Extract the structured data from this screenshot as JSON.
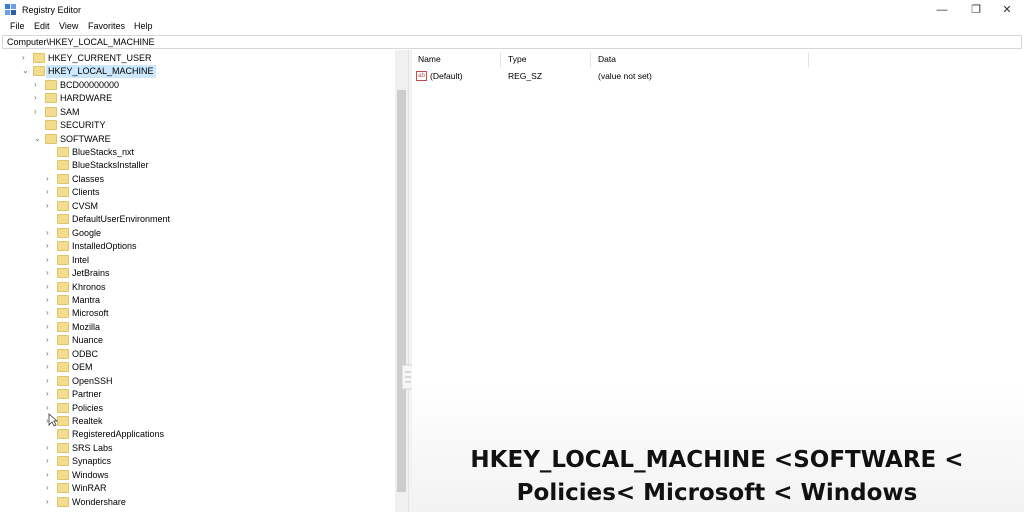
{
  "window": {
    "title": "Registry Editor",
    "minimize": "—",
    "maximize": "❐",
    "close": "✕"
  },
  "menu": [
    "File",
    "Edit",
    "View",
    "Favorites",
    "Help"
  ],
  "address": "Computer\\HKEY_LOCAL_MACHINE",
  "tree": {
    "roots": [
      {
        "label": "HKEY_CURRENT_USER",
        "expanded": false
      },
      {
        "label": "HKEY_LOCAL_MACHINE",
        "expanded": true,
        "selected": true
      }
    ],
    "hklm_children": [
      "BCD00000000",
      "HARDWARE",
      "SAM",
      "SECURITY",
      "SOFTWARE"
    ],
    "software_children": [
      "BlueStacks_nxt",
      "BlueStacksInstaller",
      "Classes",
      "Clients",
      "CVSM",
      "DefaultUserEnvironment",
      "Google",
      "InstalledOptions",
      "Intel",
      "JetBrains",
      "Khronos",
      "Mantra",
      "Microsoft",
      "Mozilla",
      "Nuance",
      "ODBC",
      "OEM",
      "OpenSSH",
      "Partner",
      "Policies",
      "Realtek",
      "RegisteredApplications",
      "SRS Labs",
      "Synaptics",
      "Windows",
      "WinRAR",
      "Wondershare"
    ]
  },
  "values": {
    "headers": {
      "name": "Name",
      "type": "Type",
      "data": "Data"
    },
    "rows": [
      {
        "icon": "ab",
        "name": "(Default)",
        "type": "REG_SZ",
        "data": "(value not set)"
      }
    ]
  },
  "caption": {
    "line1": "HKEY_LOCAL_MACHINE <SOFTWARE <",
    "line2": "Policies<  Microsoft < Windows"
  },
  "colors": {
    "folder": "#f4dc8e",
    "selection": "#cce8ff"
  }
}
